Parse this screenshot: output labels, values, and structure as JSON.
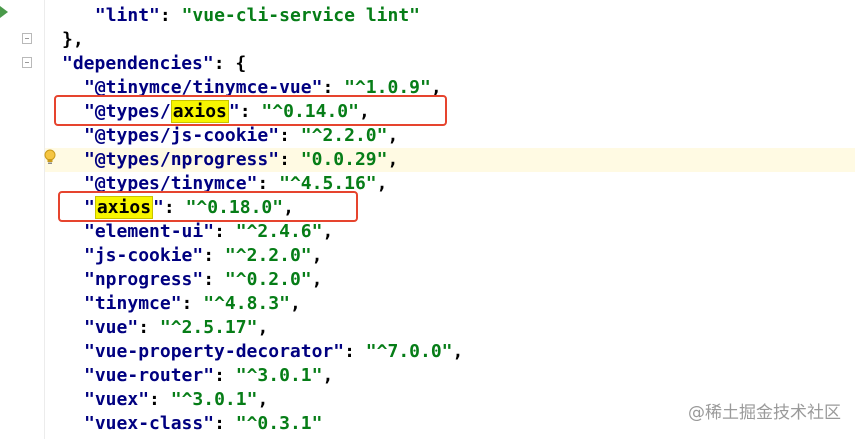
{
  "colors": {
    "key": "#000080",
    "string": "#067d17",
    "search_match": "#f7f500",
    "annotation_box": "#e6442e",
    "current_line": "#fffae3"
  },
  "icons": {
    "gutter_run": "run-arrow-icon",
    "gutter_fold": "fold-marker-icon",
    "intention": "lightbulb-icon"
  },
  "editor": {
    "lines": {
      "lint": {
        "key": "lint",
        "value": "vue-cli-service lint"
      },
      "scripts_close": "},",
      "dependencies_key": "dependencies",
      "tinymce_vue": {
        "key": "@tinymce/tinymce-vue",
        "value": "^1.0.9"
      },
      "types_axios": {
        "key_prefix": "@types/",
        "key_match": "axios",
        "value": "^0.14.0"
      },
      "types_js_cookie": {
        "key": "@types/js-cookie",
        "value": "^2.2.0"
      },
      "types_nprogress": {
        "key": "@types/nprogress",
        "value": "0.0.29"
      },
      "types_tinymce": {
        "key": "@types/tinymce",
        "value": "^4.5.16"
      },
      "axios": {
        "key_match": "axios",
        "value": "^0.18.0"
      },
      "element_ui": {
        "key": "element-ui",
        "value": "^2.4.6"
      },
      "js_cookie": {
        "key": "js-cookie",
        "value": "^2.2.0"
      },
      "nprogress": {
        "key": "nprogress",
        "value": "^0.2.0"
      },
      "tinymce": {
        "key": "tinymce",
        "value": "^4.8.3"
      },
      "vue": {
        "key": "vue",
        "value": "^2.5.17"
      },
      "vue_property_decorator": {
        "key": "vue-property-decorator",
        "value": "^7.0.0"
      },
      "vue_router": {
        "key": "vue-router",
        "value": "^3.0.1"
      },
      "vuex": {
        "key": "vuex",
        "value": "^3.0.1"
      },
      "vuex_class": {
        "key": "vuex-class",
        "value": "^0.3.1"
      }
    }
  },
  "watermark": "@稀土掘金技术社区"
}
